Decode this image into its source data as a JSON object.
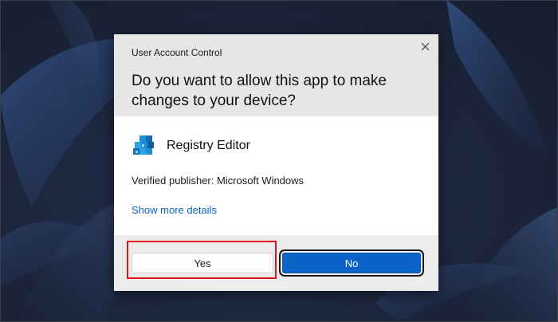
{
  "dialog": {
    "caption": "User Account Control",
    "question": "Do you want to allow this app to make changes to your device?",
    "app_name": "Registry Editor",
    "app_icon": "registry-editor-icon",
    "publisher": "Verified publisher: Microsoft Windows",
    "more_details": "Show more details",
    "close_icon": "close-icon"
  },
  "buttons": {
    "yes_label": "Yes",
    "no_label": "No"
  },
  "colors": {
    "accent": "#0a64c8",
    "link": "#0b63c4",
    "highlight": "#e0141e",
    "header_bg": "#e6e6e6",
    "footer_bg": "#ececec"
  }
}
